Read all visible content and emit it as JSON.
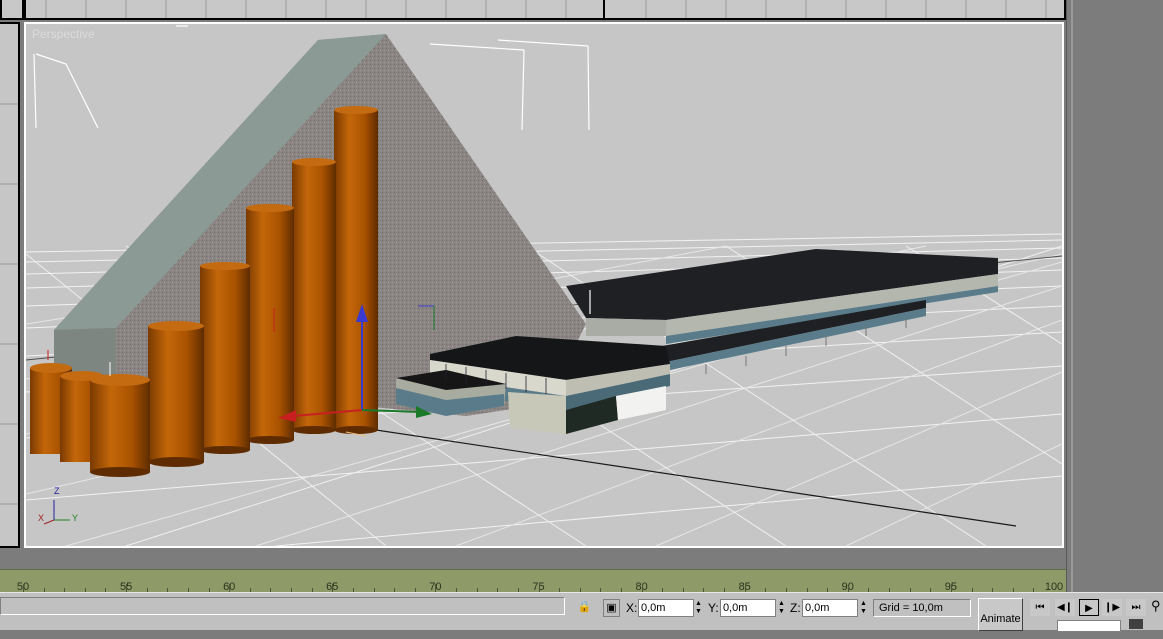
{
  "viewport": {
    "label": "Perspective"
  },
  "gizmo": {
    "x_label": "X",
    "y_label": "Y",
    "z_label": "Z"
  },
  "trackbar": {
    "ticks": [
      "50",
      "55",
      "60",
      "65",
      "70",
      "75",
      "80",
      "85",
      "90",
      "95",
      "100"
    ]
  },
  "status": {
    "x_label": "X:",
    "y_label": "Y:",
    "z_label": "Z:",
    "x_value": "0,0m",
    "y_value": "0,0m",
    "z_value": "0,0m",
    "grid_text": "Grid = 10,0m",
    "animate_label": "Animate"
  },
  "icons": {
    "lock": "lock-icon",
    "selection": "selection-icon",
    "goto_start": "go-to-start-icon",
    "prev_frame": "previous-frame-icon",
    "play": "play-icon",
    "next_frame": "next-frame-icon",
    "goto_end": "go-to-end-icon",
    "zoom": "zoom-icon"
  },
  "colors": {
    "viewport_bg": "#c6c6c6",
    "trackbar": "#8e9a67",
    "cylinder": "#b35a00",
    "roof": "#1e2023",
    "building_wall": "#d8d8cc",
    "window_band": "#5a7b8a"
  }
}
